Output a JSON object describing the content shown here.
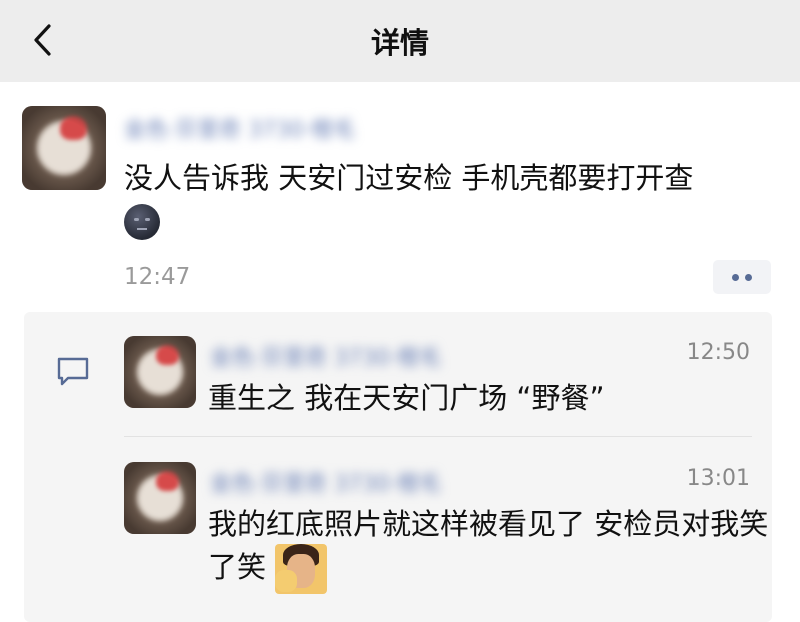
{
  "nav": {
    "title": "详情",
    "back_icon": "chevron-left-icon"
  },
  "post": {
    "author": "金色·芬里奇 3730·橙毛",
    "text_line1": "没人告诉我 天安门过安检 手机壳都要打开查",
    "emoji": "new-moon-face-emoji",
    "time": "12:47",
    "more_icon": "ellipsis-icon"
  },
  "comments": {
    "icon": "comment-icon",
    "items": [
      {
        "author": "金色·芬里奇 3730·橙毛",
        "time": "12:50",
        "text": "重生之 我在天安门广场 “野餐”"
      },
      {
        "author": "金色·芬里奇 3730·橙毛",
        "time": "13:01",
        "text_line1": "我的红底照片就这样被看见了 安检员对我笑",
        "text_line2": "了笑",
        "emoji": "facepalm-emoji"
      }
    ]
  },
  "colors": {
    "nav_bg": "#ededed",
    "nick": "#576b95",
    "comments_bg": "#f5f5f5"
  }
}
